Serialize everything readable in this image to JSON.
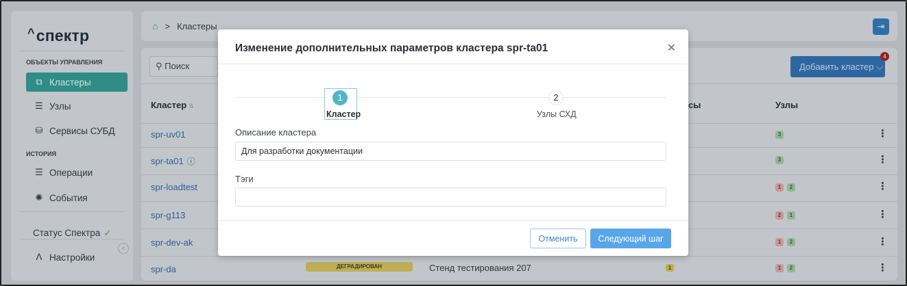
{
  "app": {
    "logo": "спектр",
    "logo_caret": "^"
  },
  "sidebar": {
    "section_objects": "ОБЪЕКТЫ УПРАВЛЕНИЯ",
    "section_history": "ИСТОРИЯ",
    "items": [
      {
        "label": "Кластеры",
        "icon": "cluster-icon"
      },
      {
        "label": "Узлы",
        "icon": "server-icon"
      },
      {
        "label": "Сервисы СУБД",
        "icon": "database-icon"
      },
      {
        "label": "Операции",
        "icon": "operations-icon"
      },
      {
        "label": "События",
        "icon": "events-icon"
      }
    ],
    "status_label": "Статус Спектра",
    "settings_label": "Настройки"
  },
  "topbar": {
    "breadcrumb_current": "Кластеры",
    "breadcrumb_separator": ">"
  },
  "content": {
    "search_placeholder": "Поиск",
    "add_button": "Добавить кластер",
    "notification_count": "4",
    "columns": {
      "cluster": "Кластер",
      "services": "сы",
      "nodes": "Узлы"
    },
    "rows": [
      {
        "name": "spr-uv01",
        "badges": [
          {
            "n": "3",
            "color": "green"
          }
        ]
      },
      {
        "name": "spr-ta01",
        "badges": [
          {
            "n": "3",
            "color": "green"
          }
        ],
        "info": true
      },
      {
        "name": "spr-loadtest",
        "badges": [
          {
            "n": "1",
            "color": "red"
          },
          {
            "n": "2",
            "color": "green"
          }
        ]
      },
      {
        "name": "spr-g113",
        "badges": [
          {
            "n": "2",
            "color": "red"
          },
          {
            "n": "1",
            "color": "green"
          }
        ]
      },
      {
        "name": "spr-dev-ak",
        "badges": [
          {
            "n": "1",
            "color": "red"
          },
          {
            "n": "2",
            "color": "green"
          }
        ]
      },
      {
        "name": "spr-da",
        "badges": [
          {
            "n": "1",
            "color": "red"
          },
          {
            "n": "2",
            "color": "green"
          }
        ],
        "status": "ДЕГРАДИРОВАН",
        "description": "Стенд тестирования 207",
        "service_badge": "1"
      }
    ]
  },
  "modal": {
    "title": "Изменение дополнительных параметров кластера spr-ta01",
    "steps": [
      {
        "number": "1",
        "label": "Кластер",
        "active": true
      },
      {
        "number": "2",
        "label": "Узлы СХД",
        "active": false
      }
    ],
    "description_label": "Описание кластера",
    "description_value": "Для разработки документации",
    "tags_label": "Тэги",
    "tags_value": "",
    "cancel_label": "Отменить",
    "next_label": "Следующий шаг"
  },
  "colors": {
    "accent_teal": "#4fb5c7",
    "primary_blue": "#58a6ea",
    "link_blue": "#3a87cc"
  }
}
